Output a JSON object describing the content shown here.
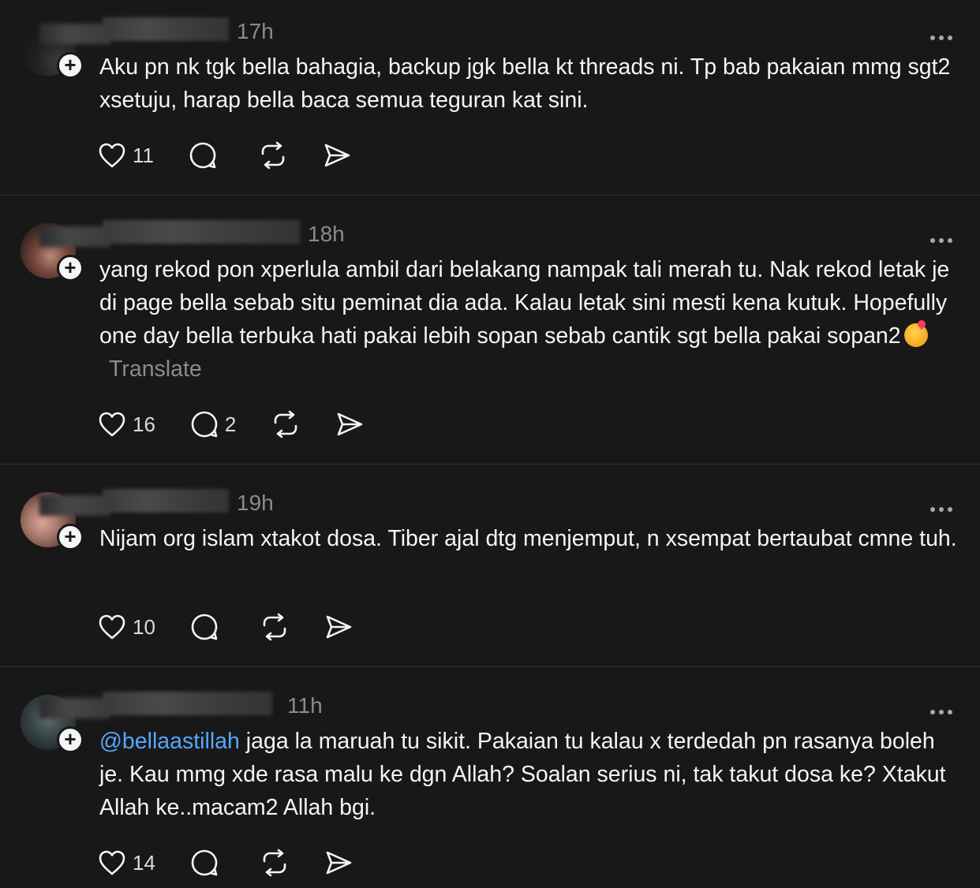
{
  "posts": [
    {
      "time": "17h",
      "text": "Aku pn nk tgk bella bahagia, backup jgk bella kt threads ni. Tp bab pakaian mmg sgt2 xsetuju, harap bella baca semua teguran kat sini.",
      "likes": "11",
      "replies": ""
    },
    {
      "time": "18h",
      "text": "yang rekod pon xperlula ambil dari belakang nampak tali merah tu. Nak rekod letak je di page bella sebab situ peminat dia ada. Kalau letak sini mesti kena kutuk. Hopefully one day bella terbuka hati pakai lebih sopan sebab cantik sgt bella pakai sopan2",
      "translate": "Translate",
      "likes": "16",
      "replies": "2"
    },
    {
      "time": "19h",
      "text": "Nijam org islam xtakot dosa. Tiber ajal dtg menjemput, n xsempat bertaubat cmne tuh.",
      "likes": "10",
      "replies": ""
    },
    {
      "time": "11h",
      "mention": "@bellaastillah",
      "text": " jaga la maruah tu sikit. Pakaian tu kalau x terdedah pn rasanya boleh je. Kau mmg xde rasa malu ke dgn Allah? Soalan serius ni, tak takut dosa ke? Xtakut Allah ke..macam2 Allah bgi.",
      "likes": "14",
      "replies": ""
    }
  ],
  "icons": {
    "like": "heart-icon",
    "reply": "comment-icon",
    "repost": "repost-icon",
    "share": "share-icon",
    "more": "more-icon",
    "follow": "plus-icon"
  },
  "colors": {
    "background": "#181818",
    "text": "#f3f5f7",
    "muted": "#8b8b8b",
    "mention": "#58a6ff",
    "divider": "#323232"
  }
}
